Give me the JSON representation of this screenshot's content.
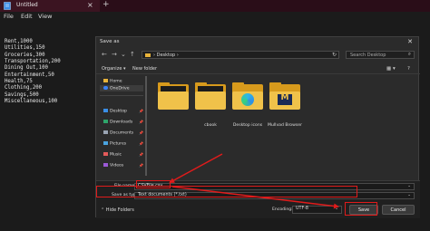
{
  "window": {
    "tab_title": "Untitled",
    "tab_close": "×",
    "tab_add": "+"
  },
  "menu": [
    "File",
    "Edit",
    "View"
  ],
  "editor": {
    "lines": [
      "Rent,1000",
      "Utilities,150",
      "Groceries,300",
      "Transportation,200",
      "Dining Out,100",
      "Entertainment,50",
      "Health,75",
      "Clothing,200",
      "Savings,500",
      "Miscellaneous,100"
    ]
  },
  "dialog": {
    "title": "Save as",
    "close": "✕",
    "address": "Desktop",
    "address_sep": "›",
    "search_placeholder": "Search Desktop",
    "organize": "Organize ▾",
    "new_folder": "New folder",
    "view_icon": "▦ ▾",
    "help_icon": "?",
    "sidebar": [
      {
        "label": "Home",
        "icon": "home-icon",
        "color": "#e8b33a",
        "pinned": false
      },
      {
        "label": "OneDrive",
        "icon": "cloud-icon",
        "color": "#3b82f6",
        "pinned": false
      },
      {
        "label": "Desktop",
        "icon": "desktop-icon",
        "color": "#3a8ee6",
        "pinned": true
      },
      {
        "label": "Downloads",
        "icon": "download-icon",
        "color": "#2ea56a",
        "pinned": true
      },
      {
        "label": "Documents",
        "icon": "document-icon",
        "color": "#9aa4b2",
        "pinned": true
      },
      {
        "label": "Pictures",
        "icon": "picture-icon",
        "color": "#4aa3df",
        "pinned": true
      },
      {
        "label": "Music",
        "icon": "music-icon",
        "color": "#e35a5a",
        "pinned": true
      },
      {
        "label": "Videos",
        "icon": "video-icon",
        "color": "#9b59d6",
        "pinned": true
      }
    ],
    "files": [
      {
        "label": "",
        "type": "folder"
      },
      {
        "label": "cbook",
        "type": "folder"
      },
      {
        "label": "Desktop icons",
        "type": "edge"
      },
      {
        "label": "Mullvad Browser",
        "type": "mullvad"
      }
    ],
    "file_name_label": "File name:",
    "file_name_value": "CSVFile.csv",
    "save_as_type_label": "Save as type:",
    "save_as_type_value": "Text documents (*.txt)",
    "hide_folders": "Hide Folders",
    "encoding_label": "Encoding:",
    "encoding_value": "UTF-8",
    "save_button": "Save",
    "cancel_button": "Cancel"
  },
  "colors": {
    "annotation": "#e01b1b",
    "folder": "#f0c24a"
  }
}
